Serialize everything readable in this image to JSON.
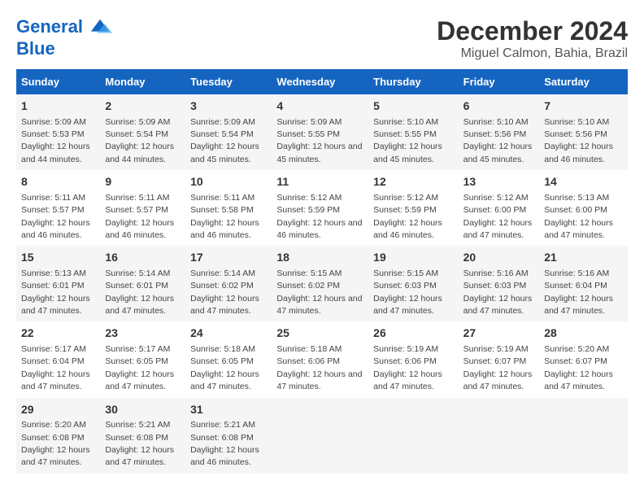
{
  "logo": {
    "line1": "General",
    "line2": "Blue"
  },
  "title": "December 2024",
  "subtitle": "Miguel Calmon, Bahia, Brazil",
  "days_header": [
    "Sunday",
    "Monday",
    "Tuesday",
    "Wednesday",
    "Thursday",
    "Friday",
    "Saturday"
  ],
  "weeks": [
    [
      {
        "num": "1",
        "rise": "5:09 AM",
        "set": "5:53 PM",
        "dh": "12 hours and 44 minutes."
      },
      {
        "num": "2",
        "rise": "5:09 AM",
        "set": "5:54 PM",
        "dh": "12 hours and 44 minutes."
      },
      {
        "num": "3",
        "rise": "5:09 AM",
        "set": "5:54 PM",
        "dh": "12 hours and 45 minutes."
      },
      {
        "num": "4",
        "rise": "5:09 AM",
        "set": "5:55 PM",
        "dh": "12 hours and 45 minutes."
      },
      {
        "num": "5",
        "rise": "5:10 AM",
        "set": "5:55 PM",
        "dh": "12 hours and 45 minutes."
      },
      {
        "num": "6",
        "rise": "5:10 AM",
        "set": "5:56 PM",
        "dh": "12 hours and 45 minutes."
      },
      {
        "num": "7",
        "rise": "5:10 AM",
        "set": "5:56 PM",
        "dh": "12 hours and 46 minutes."
      }
    ],
    [
      {
        "num": "8",
        "rise": "5:11 AM",
        "set": "5:57 PM",
        "dh": "12 hours and 46 minutes."
      },
      {
        "num": "9",
        "rise": "5:11 AM",
        "set": "5:57 PM",
        "dh": "12 hours and 46 minutes."
      },
      {
        "num": "10",
        "rise": "5:11 AM",
        "set": "5:58 PM",
        "dh": "12 hours and 46 minutes."
      },
      {
        "num": "11",
        "rise": "5:12 AM",
        "set": "5:59 PM",
        "dh": "12 hours and 46 minutes."
      },
      {
        "num": "12",
        "rise": "5:12 AM",
        "set": "5:59 PM",
        "dh": "12 hours and 46 minutes."
      },
      {
        "num": "13",
        "rise": "5:12 AM",
        "set": "6:00 PM",
        "dh": "12 hours and 47 minutes."
      },
      {
        "num": "14",
        "rise": "5:13 AM",
        "set": "6:00 PM",
        "dh": "12 hours and 47 minutes."
      }
    ],
    [
      {
        "num": "15",
        "rise": "5:13 AM",
        "set": "6:01 PM",
        "dh": "12 hours and 47 minutes."
      },
      {
        "num": "16",
        "rise": "5:14 AM",
        "set": "6:01 PM",
        "dh": "12 hours and 47 minutes."
      },
      {
        "num": "17",
        "rise": "5:14 AM",
        "set": "6:02 PM",
        "dh": "12 hours and 47 minutes."
      },
      {
        "num": "18",
        "rise": "5:15 AM",
        "set": "6:02 PM",
        "dh": "12 hours and 47 minutes."
      },
      {
        "num": "19",
        "rise": "5:15 AM",
        "set": "6:03 PM",
        "dh": "12 hours and 47 minutes."
      },
      {
        "num": "20",
        "rise": "5:16 AM",
        "set": "6:03 PM",
        "dh": "12 hours and 47 minutes."
      },
      {
        "num": "21",
        "rise": "5:16 AM",
        "set": "6:04 PM",
        "dh": "12 hours and 47 minutes."
      }
    ],
    [
      {
        "num": "22",
        "rise": "5:17 AM",
        "set": "6:04 PM",
        "dh": "12 hours and 47 minutes."
      },
      {
        "num": "23",
        "rise": "5:17 AM",
        "set": "6:05 PM",
        "dh": "12 hours and 47 minutes."
      },
      {
        "num": "24",
        "rise": "5:18 AM",
        "set": "6:05 PM",
        "dh": "12 hours and 47 minutes."
      },
      {
        "num": "25",
        "rise": "5:18 AM",
        "set": "6:06 PM",
        "dh": "12 hours and 47 minutes."
      },
      {
        "num": "26",
        "rise": "5:19 AM",
        "set": "6:06 PM",
        "dh": "12 hours and 47 minutes."
      },
      {
        "num": "27",
        "rise": "5:19 AM",
        "set": "6:07 PM",
        "dh": "12 hours and 47 minutes."
      },
      {
        "num": "28",
        "rise": "5:20 AM",
        "set": "6:07 PM",
        "dh": "12 hours and 47 minutes."
      }
    ],
    [
      {
        "num": "29",
        "rise": "5:20 AM",
        "set": "6:08 PM",
        "dh": "12 hours and 47 minutes."
      },
      {
        "num": "30",
        "rise": "5:21 AM",
        "set": "6:08 PM",
        "dh": "12 hours and 47 minutes."
      },
      {
        "num": "31",
        "rise": "5:21 AM",
        "set": "6:08 PM",
        "dh": "12 hours and 46 minutes."
      },
      null,
      null,
      null,
      null
    ]
  ]
}
